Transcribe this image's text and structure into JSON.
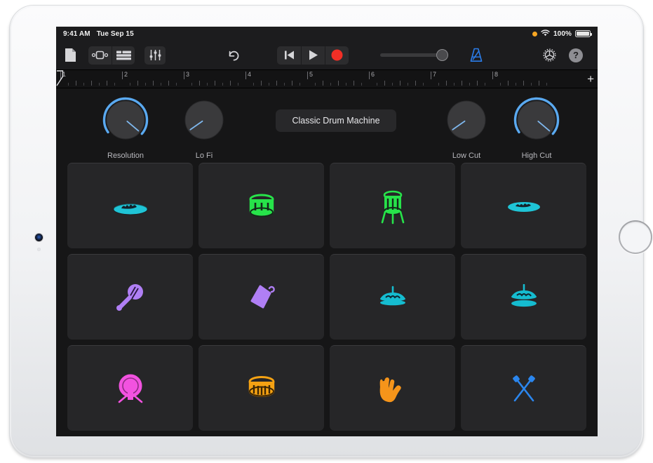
{
  "device": {
    "type": "tablet",
    "orientation": "landscape",
    "home_button": "home-button",
    "camera": "front-camera"
  },
  "status_bar": {
    "time": "9:41 AM",
    "date": "Tue Sep 15",
    "recording_indicator": "orange-dot-icon",
    "wifi": "wifi-icon",
    "battery_percent": "100%",
    "battery_icon": "battery-full-icon"
  },
  "toolbar": {
    "items": [
      {
        "name": "document-icon",
        "label": "My Songs"
      },
      {
        "name": "instrument-view-icon",
        "label": "Instrument View"
      },
      {
        "name": "tracks-view-icon",
        "label": "Tracks View"
      },
      {
        "name": "mixer-faders-icon",
        "label": "Track Controls"
      },
      {
        "name": "undo-icon",
        "label": "Undo"
      },
      {
        "name": "rewind-icon",
        "label": "Go to Beginning"
      },
      {
        "name": "play-icon",
        "label": "Play"
      },
      {
        "name": "record-icon",
        "label": "Record"
      },
      {
        "name": "metronome-icon",
        "label": "Metronome"
      },
      {
        "name": "settings-gear-icon",
        "label": "Settings"
      },
      {
        "name": "help-icon",
        "label": "Help"
      }
    ],
    "help_label": "?",
    "master_volume": 100,
    "metronome_active": true,
    "metronome_color": "#2b7dea"
  },
  "ruler": {
    "bars": [
      "1",
      "2",
      "3",
      "4",
      "5",
      "6",
      "7",
      "8"
    ],
    "playhead_bar": "1",
    "add_button_label": "+"
  },
  "plugin": {
    "preset_name": "Classic Drum Machine",
    "knobs": [
      {
        "name": "resolution-knob",
        "label": "Resolution",
        "value": 88
      },
      {
        "name": "lo-fi-knob",
        "label": "Lo Fi",
        "value": 0
      },
      {
        "name": "low-cut-knob",
        "label": "Low Cut",
        "value": 0
      },
      {
        "name": "high-cut-knob",
        "label": "High Cut",
        "value": 88
      }
    ],
    "knob_arc_color": "#5aa9f0",
    "knob_pointer_color": "#7fb8ee"
  },
  "pads": [
    {
      "name": "pad-closed-hi-hat",
      "icon": "closed-hi-hat-icon",
      "color": "#1fc4d6"
    },
    {
      "name": "pad-kick-drum",
      "icon": "kick-drum-icon",
      "color": "#27e34a"
    },
    {
      "name": "pad-floor-tom",
      "icon": "floor-tom-icon",
      "color": "#27e34a"
    },
    {
      "name": "pad-hi-hat-pedal",
      "icon": "hi-hat-pedal-icon",
      "color": "#1fc4d6"
    },
    {
      "name": "pad-maraca",
      "icon": "maraca-icon",
      "color": "#b07ff5"
    },
    {
      "name": "pad-cowbell",
      "icon": "cowbell-icon",
      "color": "#b07ff5"
    },
    {
      "name": "pad-hi-hat-closed-stand",
      "icon": "hi-hat-stand-closed-icon",
      "color": "#15bcd0"
    },
    {
      "name": "pad-hi-hat-open-stand",
      "icon": "hi-hat-stand-open-icon",
      "color": "#15bcd0"
    },
    {
      "name": "pad-gong",
      "icon": "gong-icon",
      "color": "#f252e0"
    },
    {
      "name": "pad-snare-drum",
      "icon": "snare-drum-icon",
      "color": "#f5a213"
    },
    {
      "name": "pad-hand-clap",
      "icon": "hand-clap-icon",
      "color": "#f5941a"
    },
    {
      "name": "pad-drumsticks",
      "icon": "drumsticks-icon",
      "color": "#2b86ee"
    }
  ]
}
